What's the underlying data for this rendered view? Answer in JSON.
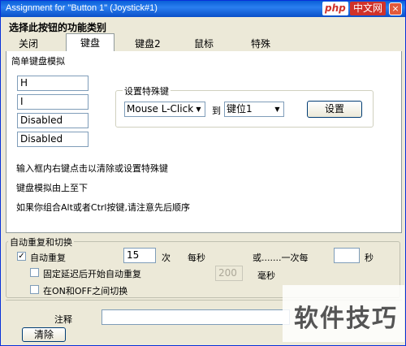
{
  "window": {
    "title": "Assignment for \"Button 1\" (Joystick#1)",
    "close_glyph": "×",
    "watermark_php": "php",
    "watermark_cn": "中文网"
  },
  "heading": "选择此按钮的功能类别",
  "tabs": [
    {
      "label": "关闭",
      "active": false
    },
    {
      "label": "键盘",
      "active": true
    },
    {
      "label": "键盘2",
      "active": false
    },
    {
      "label": "鼠标",
      "active": false
    },
    {
      "label": "特殊",
      "active": false
    }
  ],
  "simple": {
    "legend": "简单键盘模拟",
    "keys": [
      "H",
      "I",
      "Disabled",
      "Disabled"
    ]
  },
  "special": {
    "legend": "设置特殊键",
    "mouse_combo": "Mouse L-Click",
    "to_label": "到",
    "slot_combo": "键位1",
    "set_button": "设置"
  },
  "info": [
    "输入框内右键点击以清除或设置特殊键",
    "键盘模拟由上至下",
    "如果你组合Alt或者Ctrl按键,请注意先后顺序"
  ],
  "repeat": {
    "legend": "自动重复和切换",
    "auto_repeat_label": "自动重复",
    "auto_repeat_checked": true,
    "times_value": "15",
    "times_unit": "次",
    "per_sec": "每秒",
    "or_each": "或.......一次每",
    "seconds_value": "",
    "sec_unit": "秒",
    "delay_label": "固定延迟后开始自动重复",
    "delay_checked": false,
    "delay_value": "200",
    "ms_unit": "毫秒",
    "toggle_label": "在ON和OFF之间切换",
    "toggle_checked": false
  },
  "note": {
    "label": "注释",
    "value": ""
  },
  "clear_button": "清除",
  "watermark_bottom": "软件技巧"
}
